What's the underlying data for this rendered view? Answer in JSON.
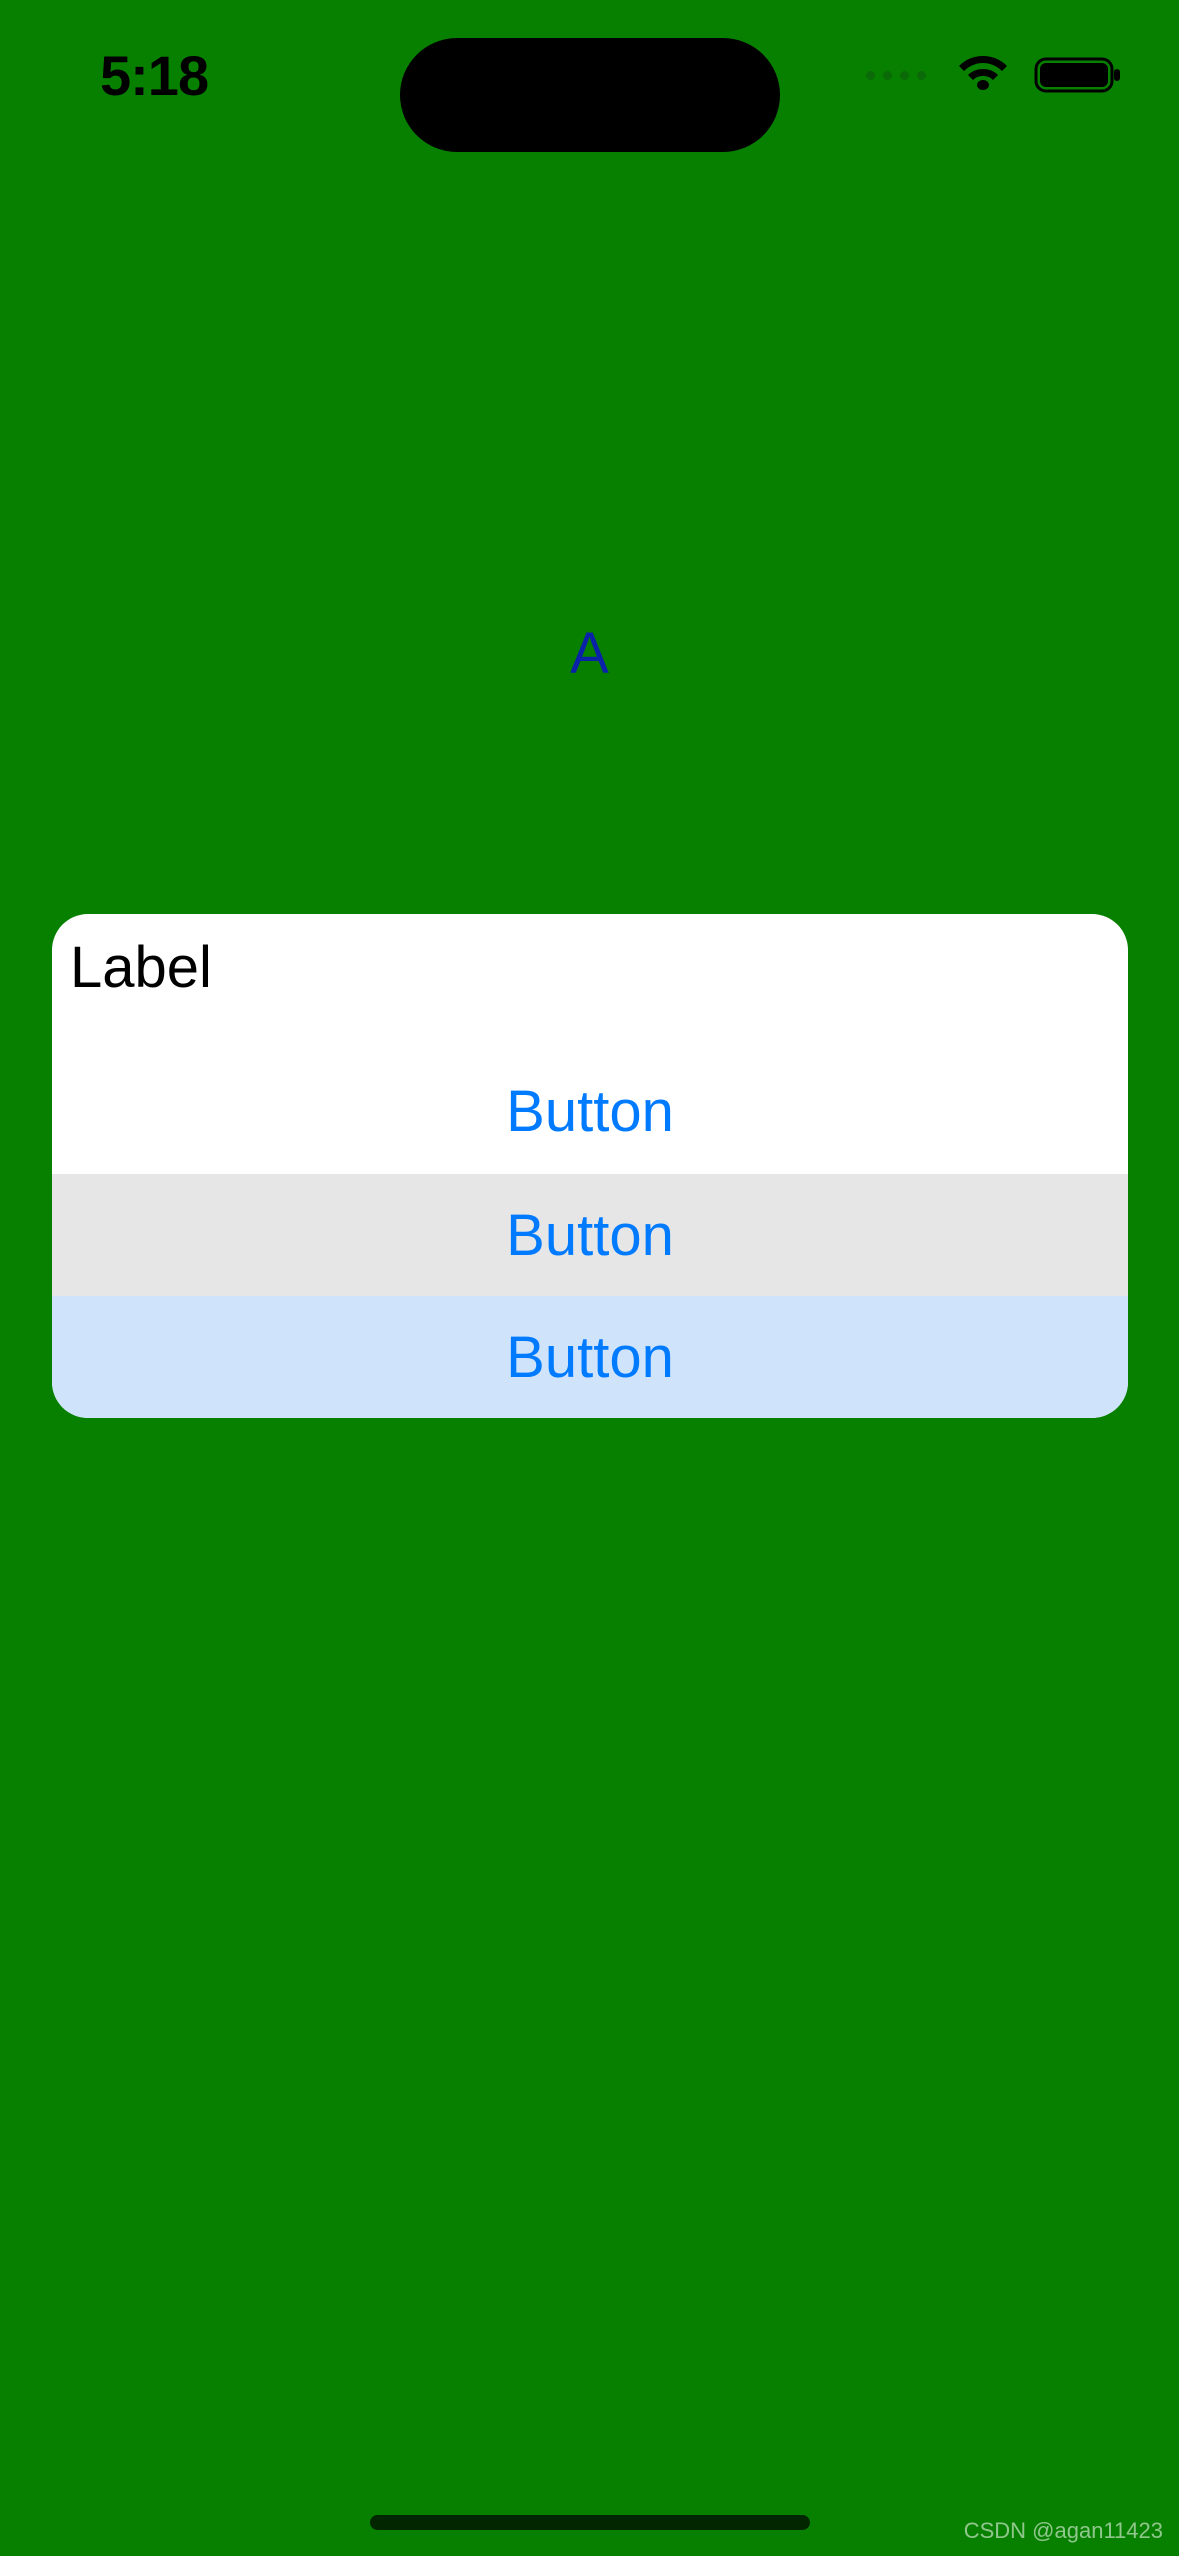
{
  "status_bar": {
    "time": "5:18"
  },
  "content": {
    "letter": "A"
  },
  "panel": {
    "label": "Label",
    "buttons": [
      "Button",
      "Button",
      "Button"
    ]
  },
  "watermark": "CSDN @agan11423"
}
